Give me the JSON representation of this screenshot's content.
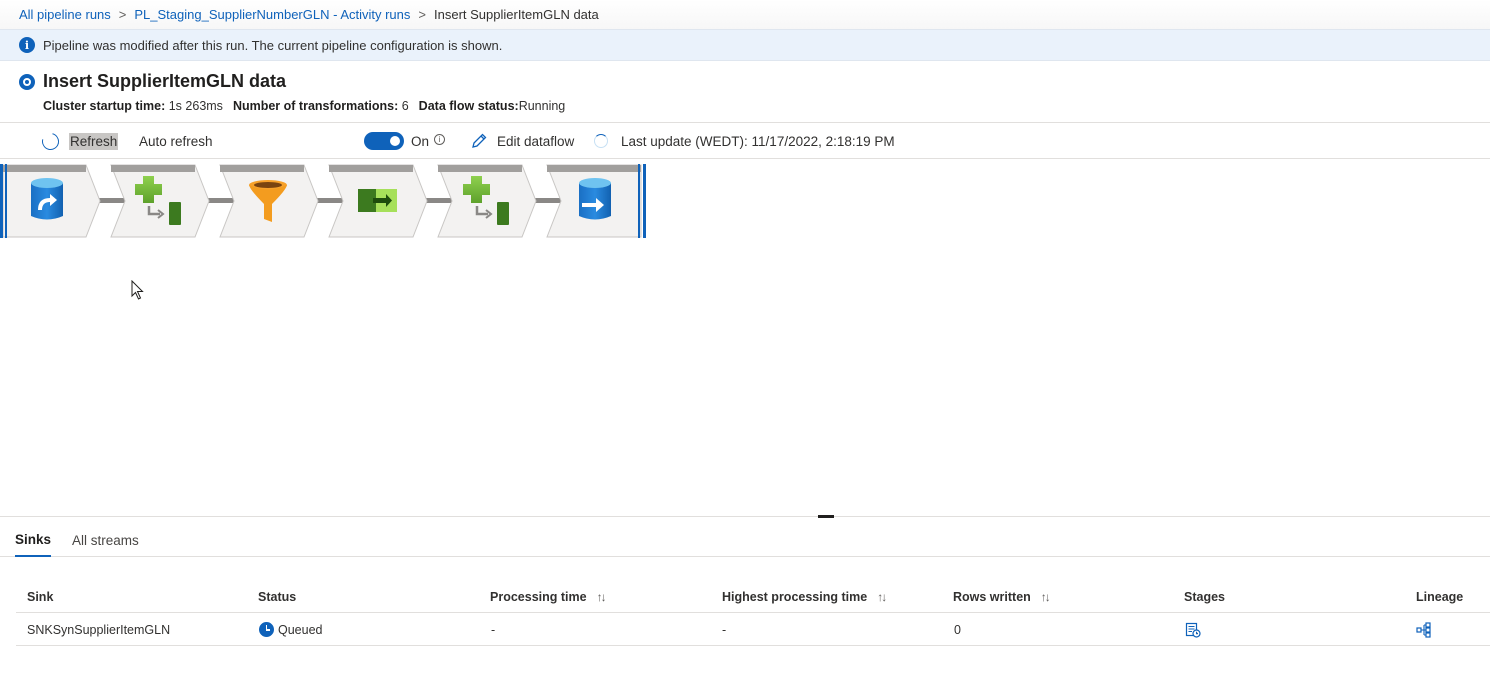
{
  "breadcrumb": {
    "items": [
      "All pipeline runs",
      "PL_Staging_SupplierNumberGLN - Activity runs"
    ],
    "separator": ">",
    "current": "Insert SupplierItemGLN data"
  },
  "banner": {
    "icon": "info-icon",
    "text": "Pipeline was modified after this run. The current pipeline configuration is shown."
  },
  "header": {
    "title": "Insert SupplierItemGLN data",
    "cluster_label": "Cluster startup time:",
    "cluster_value": "1s 263ms",
    "transformations_label": "Number of transformations:",
    "transformations_value": "6",
    "status_label": "Data flow status:",
    "status_value": "Running"
  },
  "toolbar": {
    "refresh_label": "Refresh",
    "auto_refresh_label": "Auto refresh",
    "toggle_label": "On",
    "toggle_on": true,
    "edit_label": "Edit dataflow",
    "last_update": "Last update (WEDT): 11/17/2022, 2:18:19 PM"
  },
  "flow": {
    "nodes": [
      {
        "icon": "source-database-icon"
      },
      {
        "icon": "derived-column-icon"
      },
      {
        "icon": "filter-funnel-icon"
      },
      {
        "icon": "select-icon"
      },
      {
        "icon": "derived-column-icon"
      },
      {
        "icon": "sink-database-icon"
      }
    ]
  },
  "tabs": [
    {
      "label": "Sinks",
      "active": true
    },
    {
      "label": "All streams",
      "active": false
    }
  ],
  "table": {
    "columns": [
      "Sink",
      "Status",
      "Processing time",
      "Highest processing time",
      "Rows written",
      "Stages",
      "Lineage"
    ],
    "rows": [
      {
        "sink": "SNKSynSupplierItemGLN",
        "status": "Queued",
        "processing_time": "-",
        "highest_processing_time": "-",
        "rows_written": "0",
        "stages_icon": "stages-icon",
        "lineage_icon": "lineage-icon"
      }
    ]
  },
  "colors": {
    "accent": "#0f62ba",
    "banner_bg": "#eaf2fb"
  }
}
